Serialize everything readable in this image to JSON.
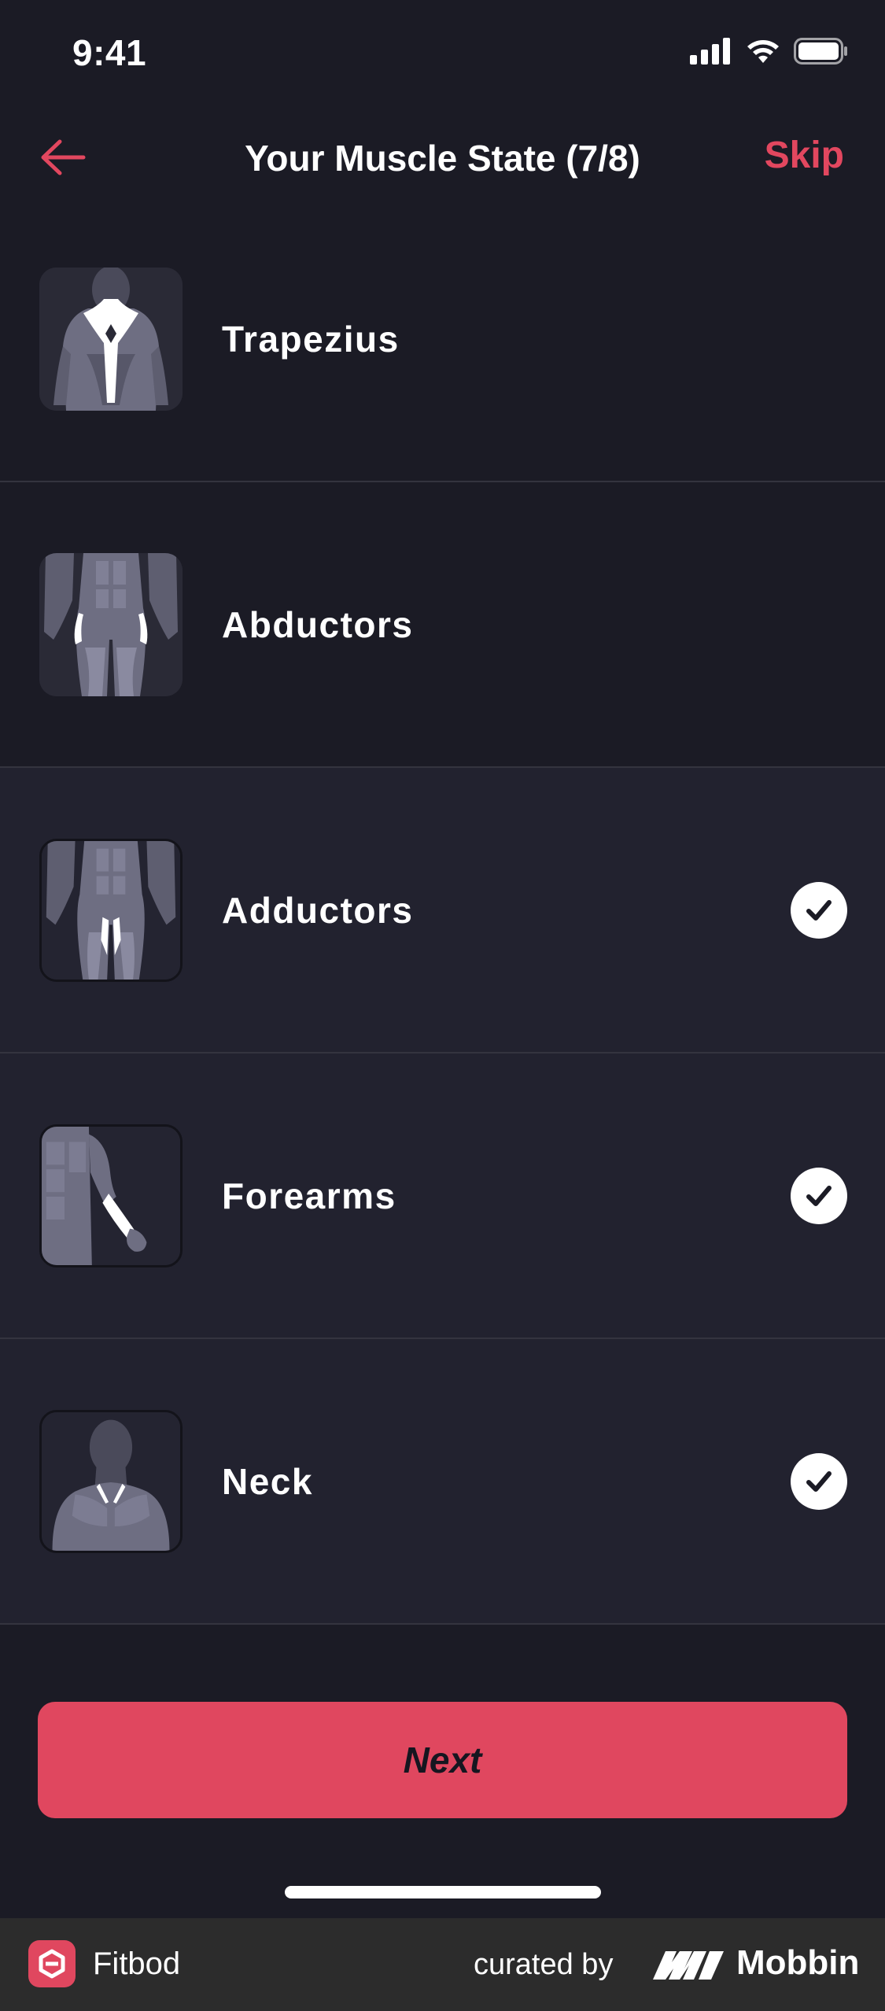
{
  "status_bar": {
    "time": "9:41",
    "icons": [
      "cellular-signal-icon",
      "wifi-icon",
      "battery-icon"
    ]
  },
  "nav": {
    "back_icon": "arrow-left-icon",
    "title": "Your Muscle State (7/8)",
    "skip_label": "Skip"
  },
  "muscles": [
    {
      "label": "Trapezius",
      "selected": false,
      "icon": "trapezius-icon"
    },
    {
      "label": "Abductors",
      "selected": false,
      "icon": "abductors-icon"
    },
    {
      "label": "Adductors",
      "selected": true,
      "icon": "adductors-icon"
    },
    {
      "label": "Forearms",
      "selected": true,
      "icon": "forearms-icon"
    },
    {
      "label": "Neck",
      "selected": true,
      "icon": "neck-icon"
    }
  ],
  "next_label": "Next",
  "footer": {
    "app_name": "Fitbod",
    "curated_by": "curated by",
    "brand": "Mobbin"
  },
  "colors": {
    "background": "#1b1b25",
    "selected_row": "#22222f",
    "accent": "#e0475f",
    "text": "#ffffff"
  }
}
